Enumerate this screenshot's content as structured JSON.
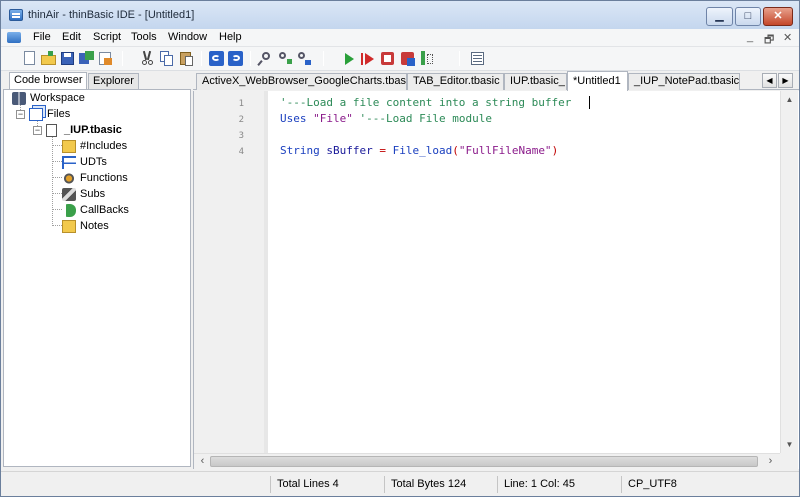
{
  "window": {
    "title": "thinAir - thinBasic IDE - [Untitled1]"
  },
  "title_buttons": {
    "minimize": "▁",
    "maximize": "□",
    "close": "✕"
  },
  "menu": {
    "items": [
      "File",
      "Edit",
      "Script",
      "Tools",
      "Window",
      "Help"
    ],
    "mdi_controls": [
      "_",
      "🗗",
      "✕"
    ]
  },
  "toolbar": {
    "buttons": [
      "new-file",
      "open-folder",
      "save",
      "save-all",
      "print-preview",
      "cut",
      "copy",
      "paste",
      "undo",
      "redo",
      "find",
      "find-next",
      "replace",
      "run",
      "debug",
      "script-properties",
      "bundle",
      "obfuscate",
      "toggle-panel"
    ]
  },
  "left_panel": {
    "tabs": [
      "Code browser",
      "Explorer"
    ],
    "tree": {
      "workspace": "Workspace",
      "files": "Files",
      "file": "_IUP.tbasic",
      "children": [
        "#Includes",
        "UDTs",
        "Functions",
        "Subs",
        "CallBacks",
        "Notes"
      ]
    }
  },
  "doc_tabs": [
    "ActiveX_WebBrowser_GoogleCharts.tbasic",
    "TAB_Editor.tbasic",
    "IUP.tbasic_",
    "*Untitled1",
    "_IUP_NotePad.tbasic"
  ],
  "editor": {
    "line_numbers": [
      "1",
      "2",
      "3",
      "4"
    ],
    "lines": {
      "l1": {
        "comment": "'---Load a file content into a string buffer"
      },
      "l2": {
        "kw": "Uses",
        "str": "\"File\"",
        "comment": "'---Load File module"
      },
      "l4": {
        "kw": "String",
        "var": "sBuffer",
        "op": "=",
        "fn": "File_load",
        "open": "(",
        "str": "\"FullFileName\"",
        "close": ")"
      }
    }
  },
  "status": {
    "total_lines": "Total Lines 4",
    "total_bytes": "Total Bytes 124",
    "position": "Line: 1 Col: 45",
    "encoding": "CP_UTF8"
  },
  "colors": {
    "comment": "#2c8a57",
    "keyword": "#1a3fbf",
    "string": "#8a1a8a",
    "operator": "#c00000"
  }
}
